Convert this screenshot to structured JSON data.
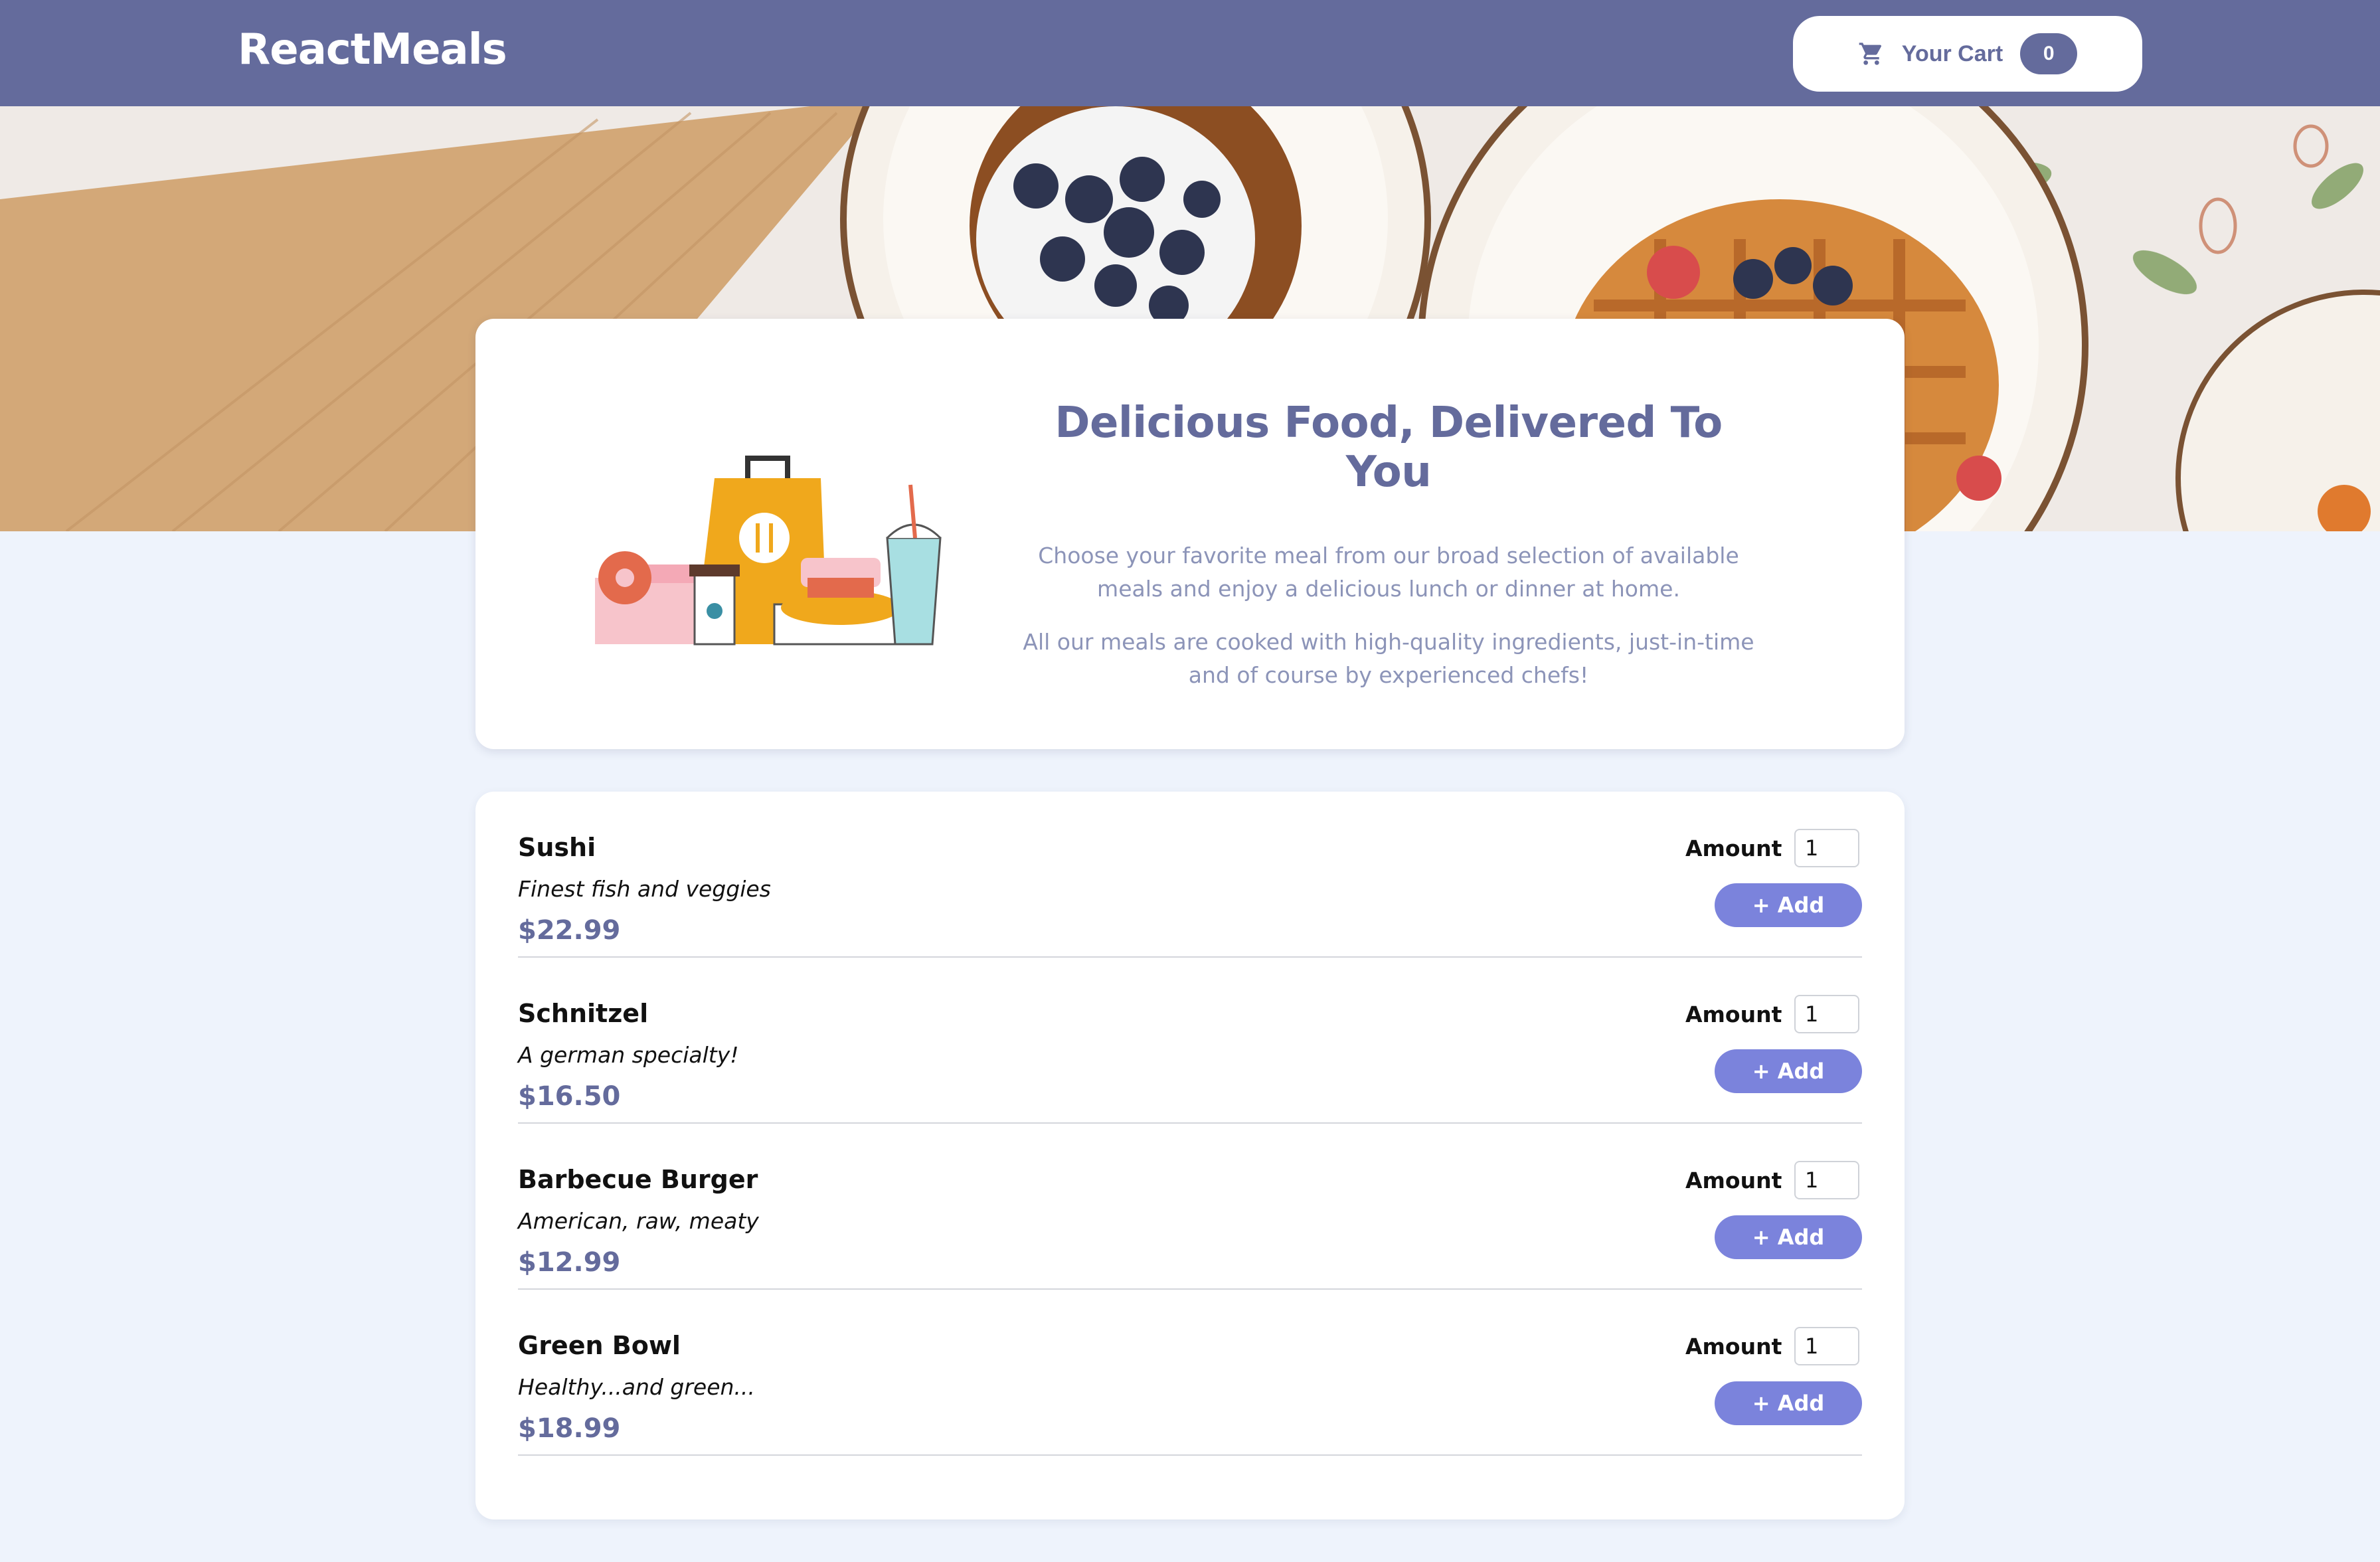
{
  "header": {
    "brand": "ReactMeals",
    "cart_label": "Your Cart",
    "cart_count": "0"
  },
  "summary": {
    "title": "Delicious Food, Delivered To You",
    "paragraph_1": "Choose your favorite meal from our broad selection of available meals and enjoy a delicious lunch or dinner at home.",
    "paragraph_2": "All our meals are cooked with high-quality ingredients, just-in-time and of course by experienced chefs!"
  },
  "meals": [
    {
      "name": "Sushi",
      "description": "Finest fish and veggies",
      "price": "$22.99",
      "amount_label": "Amount",
      "amount_value": "1",
      "add_label": "+ Add"
    },
    {
      "name": "Schnitzel",
      "description": "A german specialty!",
      "price": "$16.50",
      "amount_label": "Amount",
      "amount_value": "1",
      "add_label": "+ Add"
    },
    {
      "name": "Barbecue Burger",
      "description": "American, raw, meaty",
      "price": "$12.99",
      "amount_label": "Amount",
      "amount_value": "1",
      "add_label": "+ Add"
    },
    {
      "name": "Green Bowl",
      "description": "Healthy...and green...",
      "price": "$18.99",
      "amount_label": "Amount",
      "amount_value": "1",
      "add_label": "+ Add"
    }
  ],
  "colors": {
    "header_bg": "#646b9c",
    "page_bg": "#eef3fc",
    "accent_button": "#7b83dc",
    "price_text": "#646b9c"
  },
  "icons": {
    "cart": "shopping-cart-icon"
  }
}
